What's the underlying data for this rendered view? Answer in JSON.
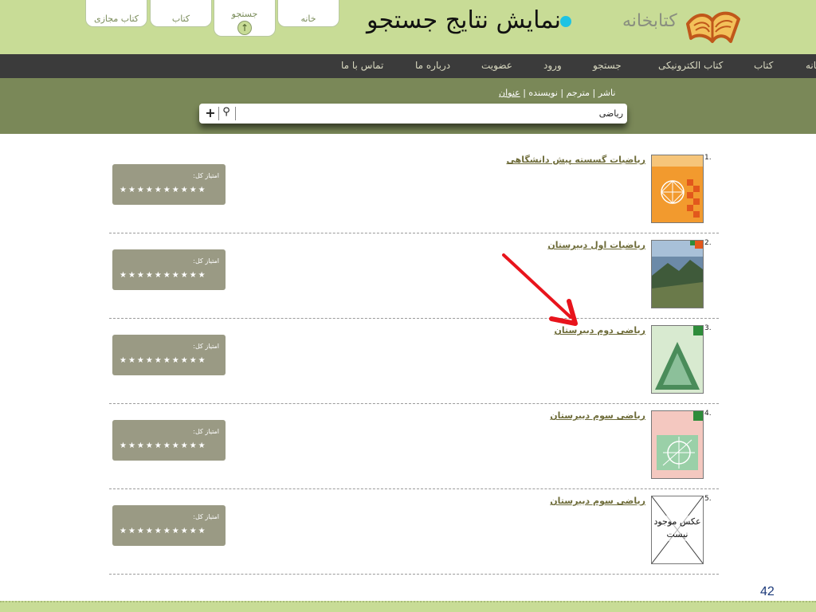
{
  "header": {
    "title": "نمایش نتایج جستجو",
    "logo_text": "کتابخانه",
    "tabs": [
      "کتاب مجازی",
      "کتاب",
      "جستجو",
      "خانه"
    ],
    "active_tab": "جستجو",
    "accent_color": "#1ec3e3",
    "bg_color": "#c8dc96"
  },
  "nav": {
    "items": [
      "خانه",
      "کتاب",
      "کتاب الکترونیکی",
      "جستجو",
      "ورود",
      "عضویت",
      "درباره ما",
      "تماس با ما"
    ]
  },
  "search": {
    "filters": [
      "عنوان",
      "نویسنده",
      "مترجم",
      "ناشر"
    ],
    "separator": " | ",
    "active_filter": "عنوان",
    "value": "ریاضی"
  },
  "results": [
    {
      "number": "1.",
      "title": "ریاضیات گسسته پیش دانشگاهی",
      "rating_label": "امتیاز کل:",
      "cover": "discrete-math-cover"
    },
    {
      "number": "2.",
      "title": "ریاضیات اول دبیرستان",
      "rating_label": "امتیاز کل:",
      "cover": "math-grade1-cover"
    },
    {
      "number": "3.",
      "title": "ریاضی دوم دبیرستان",
      "rating_label": "امتیاز کل:",
      "cover": "math-grade2-cover"
    },
    {
      "number": "4.",
      "title": "ریاضی سوم دبیرستان",
      "rating_label": "امتیاز کل:",
      "cover": "math-grade3-cover"
    },
    {
      "number": "5.",
      "title": "ریاضی سوم دبیرستان",
      "rating_label": "امتیاز کل:",
      "cover": "no-image",
      "cover_text": "عکس موجود نیست"
    }
  ],
  "stars": "★★★★★★★★★★",
  "page_number": "42",
  "colors": {
    "navbar": "#3b3b3b",
    "search_band": "#7a8858",
    "rating_box": "#9a9a84",
    "arrow": "#e8141c"
  },
  "annotation": "red-arrow"
}
